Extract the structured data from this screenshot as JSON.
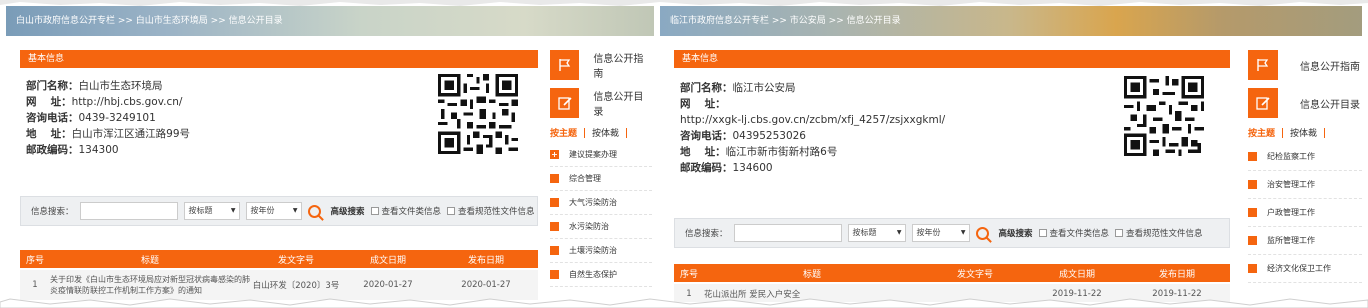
{
  "left": {
    "breadcrumb": "白山市政府信息公开专栏 >> 白山市生态环境局 >> 信息公开目录",
    "section_title": "基本信息",
    "info": [
      {
        "label": "部门名称：",
        "value": "白山市生态环境局"
      },
      {
        "label": "网　 址：",
        "value": "http://hbj.cbs.gov.cn/"
      },
      {
        "label": "咨询电话：",
        "value": "0439-3249101"
      },
      {
        "label": "地　 址：",
        "value": "白山市浑江区通江路99号"
      },
      {
        "label": "邮政编码：",
        "value": "134300"
      }
    ],
    "search": {
      "label": "信息搜索：",
      "title_select": "按标题",
      "year_select": "按年份",
      "advanced": "高级搜索",
      "check1": "查看文件类信息",
      "check2": "查看规范性文件信息"
    },
    "table": {
      "headers": [
        "序号",
        "标题",
        "发文字号",
        "成文日期",
        "发布日期"
      ],
      "rows": [
        {
          "no": "1",
          "title": "关于印发《白山市生态环境局应对新型冠状病毒感染的肺炎疫情联防联控工作机制工作方案》的通知",
          "doc_no": "白山环发〔2020〕3号",
          "written": "2020-01-27",
          "published": "2020-01-27"
        }
      ]
    },
    "sidebar": {
      "guide": "信息公开指南",
      "catalog": "信息公开目录",
      "tab_topic": "按主题",
      "tab_genre": "按体裁",
      "categories": [
        "建议提案办理",
        "综合管理",
        "大气污染防治",
        "水污染防治",
        "土壤污染防治",
        "自然生态保护"
      ]
    }
  },
  "right": {
    "breadcrumb": "临江市政府信息公开专栏 >> 市公安局 >> 信息公开目录",
    "section_title": "基本信息",
    "info": [
      {
        "label": "部门名称：",
        "value": "临江市公安局"
      },
      {
        "label": "网　 址：",
        "value": ""
      },
      {
        "label": "",
        "value": "http://xxgk-lj.cbs.gov.cn/zcbm/xfj_4257/zsjxxgkml/"
      },
      {
        "label": "咨询电话：",
        "value": "04395253026"
      },
      {
        "label": "地　 址：",
        "value": "临江市新市街新村路6号"
      },
      {
        "label": "邮政编码：",
        "value": "134600"
      }
    ],
    "search": {
      "label": "信息搜索：",
      "title_select": "按标题",
      "year_select": "按年份",
      "advanced": "高级搜索",
      "check1": "查看文件类信息",
      "check2": "查看规范性文件信息"
    },
    "table": {
      "headers": [
        "序号",
        "标题",
        "发文字号",
        "成文日期",
        "发布日期"
      ],
      "rows": [
        {
          "no": "1",
          "title": "花山派出所 爱民入户安全",
          "doc_no": "",
          "written": "2019-11-22",
          "published": "2019-11-22"
        }
      ]
    },
    "sidebar": {
      "guide": "信息公开指南",
      "catalog": "信息公开目录",
      "tab_topic": "按主题",
      "tab_genre": "按体裁",
      "categories": [
        "纪检监察工作",
        "治安管理工作",
        "户政管理工作",
        "监所管理工作",
        "经济文化保卫工作"
      ]
    }
  },
  "colors": {
    "accent": "#f5650f",
    "row_bg": "#f4f4f4",
    "search_bg": "#eef0f2"
  }
}
